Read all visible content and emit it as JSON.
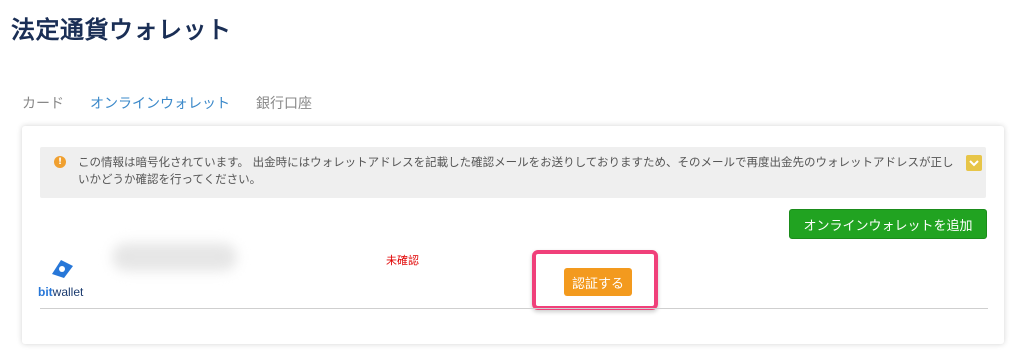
{
  "page": {
    "title": "法定通貨ウォレット"
  },
  "tabs": [
    {
      "label": "カード",
      "active": false
    },
    {
      "label": "オンラインウォレット",
      "active": true
    },
    {
      "label": "銀行口座",
      "active": false
    }
  ],
  "notice": {
    "icon": "info-icon",
    "text": "この情報は暗号化されています。 出金時にはウォレットアドレスを記載した確認メールをお送りしておりますため、そのメールで再度出金先のウォレットアドレスが正しいかどうか確認を行ってください。",
    "toggle_icon": "chevron-down-icon"
  },
  "actions": {
    "add_wallet_label": "オンラインウォレットを追加"
  },
  "wallet": {
    "logo_text_prefix": "bit",
    "logo_text_suffix": "wallet",
    "status": "未確認",
    "verify_label": "認証する"
  },
  "colors": {
    "title": "#1a2e55",
    "active_tab": "#3a88c9",
    "add_button": "#21a321",
    "verify_button": "#f39a1e",
    "status": "#e00000",
    "highlight": "#f0407a",
    "notice_toggle": "#e7c548"
  }
}
